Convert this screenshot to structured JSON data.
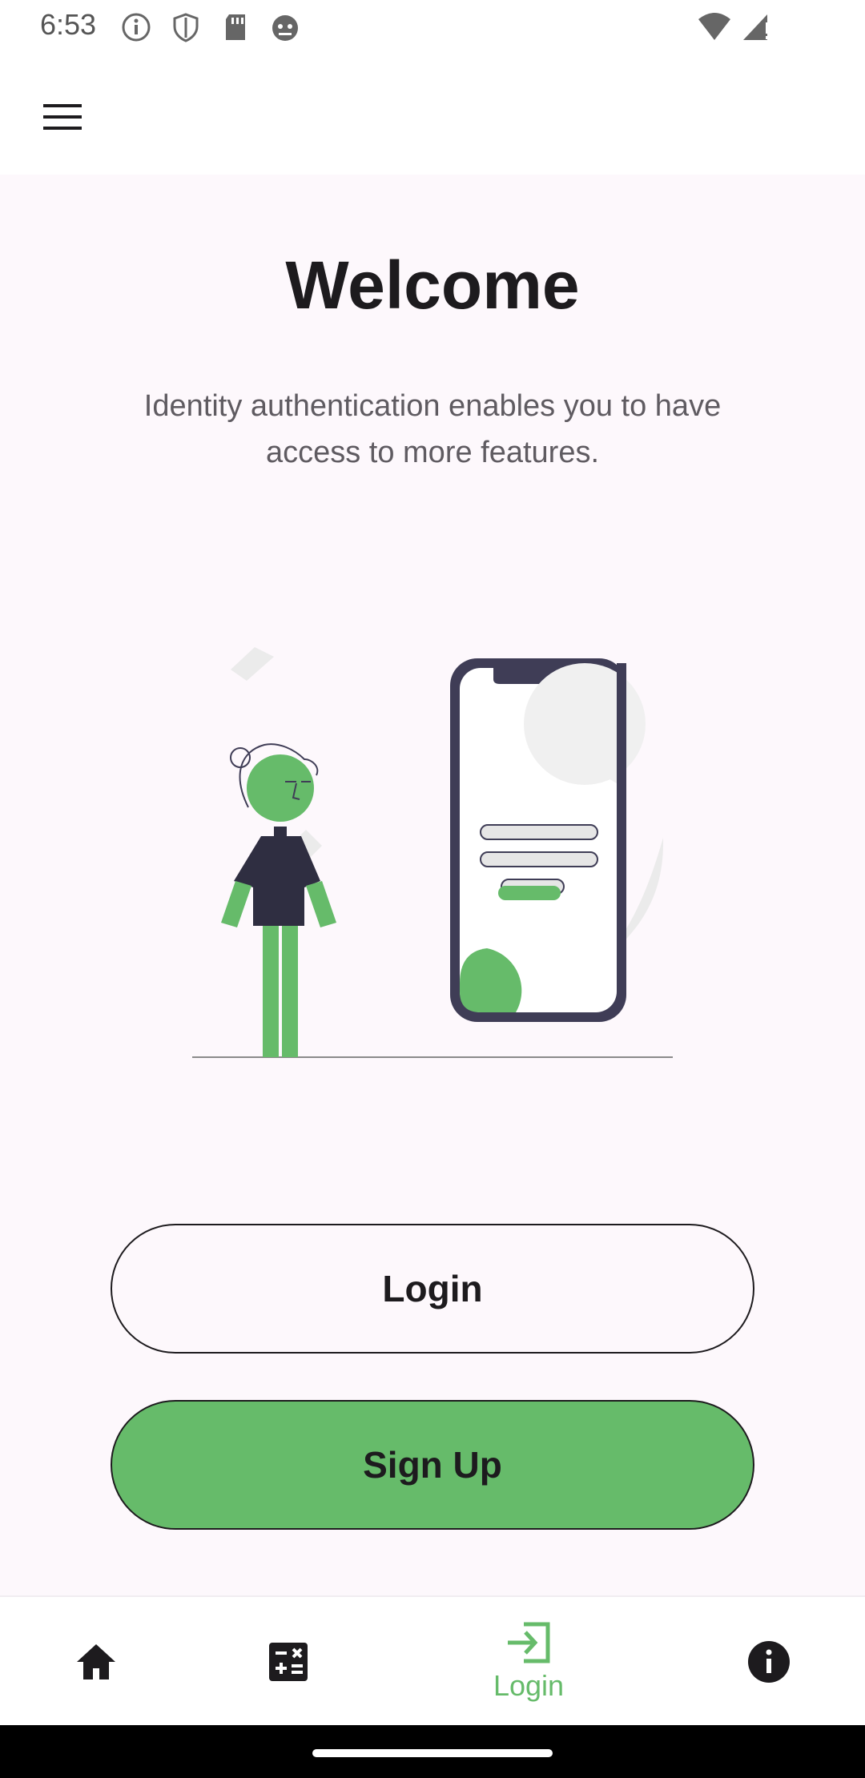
{
  "status_bar": {
    "time": "6:53"
  },
  "header": {
    "menu_icon": "hamburger-menu-icon"
  },
  "main": {
    "title": "Welcome",
    "subtitle": "Identity authentication enables you to have access to more features.",
    "illustration": "person-standing-beside-phone-login-illustration",
    "login_label": "Login",
    "signup_label": "Sign Up"
  },
  "bottom_nav": {
    "items": [
      {
        "icon": "home-icon",
        "label": ""
      },
      {
        "icon": "calculator-icon",
        "label": ""
      },
      {
        "icon": "login-icon",
        "label": "Login",
        "active": true
      },
      {
        "icon": "info-icon",
        "label": ""
      }
    ]
  },
  "colors": {
    "accent": "#66bb6a",
    "background": "#fdf8fc",
    "text": "#1d1b1e",
    "subtext": "#5f5b61"
  }
}
